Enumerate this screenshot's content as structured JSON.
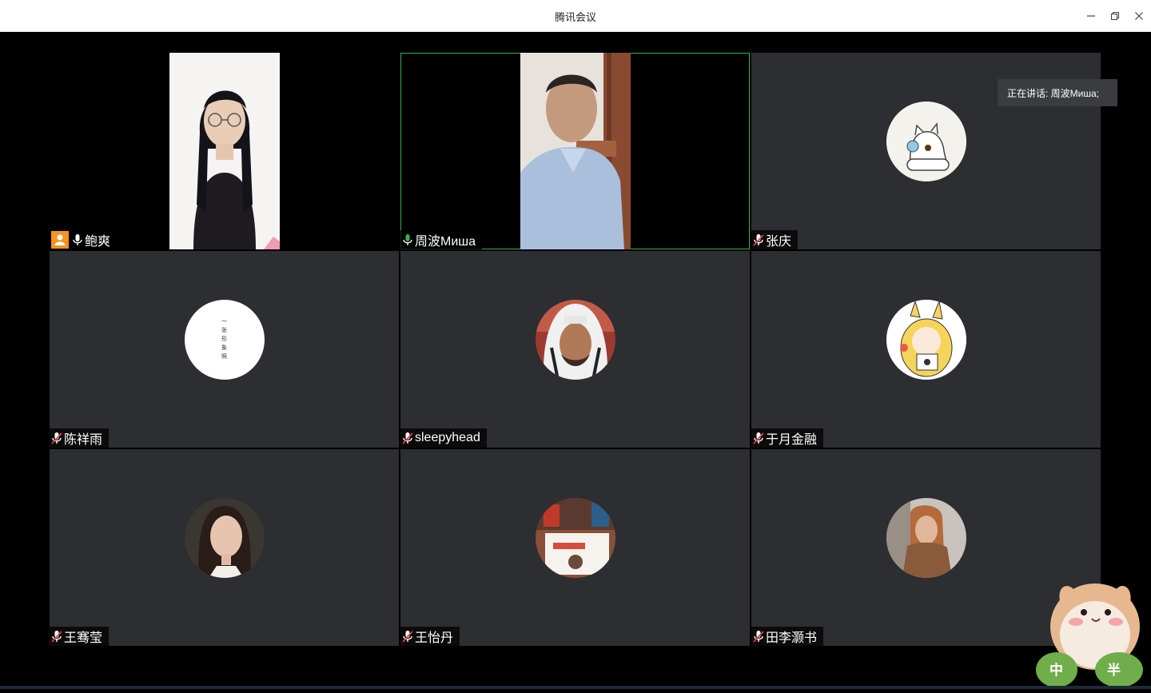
{
  "window": {
    "title": "腾讯会议",
    "controls": {
      "minimize": "minimize-icon",
      "restore": "restore-icon",
      "close": "close-icon"
    }
  },
  "speaking": {
    "text": "正在讲话: 周波Миша;"
  },
  "participants": [
    {
      "name": "鲍爽",
      "video": true,
      "host": true,
      "mic": "on"
    },
    {
      "name": "周波Миша",
      "video": true,
      "active": true,
      "mic": "speaking"
    },
    {
      "name": "张庆",
      "video": false,
      "mic": "muted",
      "avatar": "cartoon-cat-avatar"
    },
    {
      "name": "陈祥雨",
      "video": false,
      "mic": "muted",
      "avatar": "text-avatar",
      "avatar_text": "一张形象照"
    },
    {
      "name": "sleepyhead",
      "video": false,
      "mic": "muted",
      "avatar": "photo-avatar"
    },
    {
      "name": "于月金融",
      "video": false,
      "mic": "muted",
      "avatar": "pikachu-avatar"
    },
    {
      "name": "王骞莹",
      "video": false,
      "mic": "muted",
      "avatar": "photo-avatar"
    },
    {
      "name": "王怡丹",
      "video": false,
      "mic": "muted",
      "avatar": "photo-avatar"
    },
    {
      "name": "田李灏书",
      "video": false,
      "mic": "muted",
      "avatar": "photo-avatar"
    }
  ],
  "mascot": {
    "badge_left": "中",
    "badge_right": "半"
  },
  "colors": {
    "tile": "#2c2e31",
    "active_border": "#2fb550",
    "host_badge": "#f7931e",
    "mic_speaking": "#2fb550",
    "mic_muted": "#e23c3c"
  }
}
